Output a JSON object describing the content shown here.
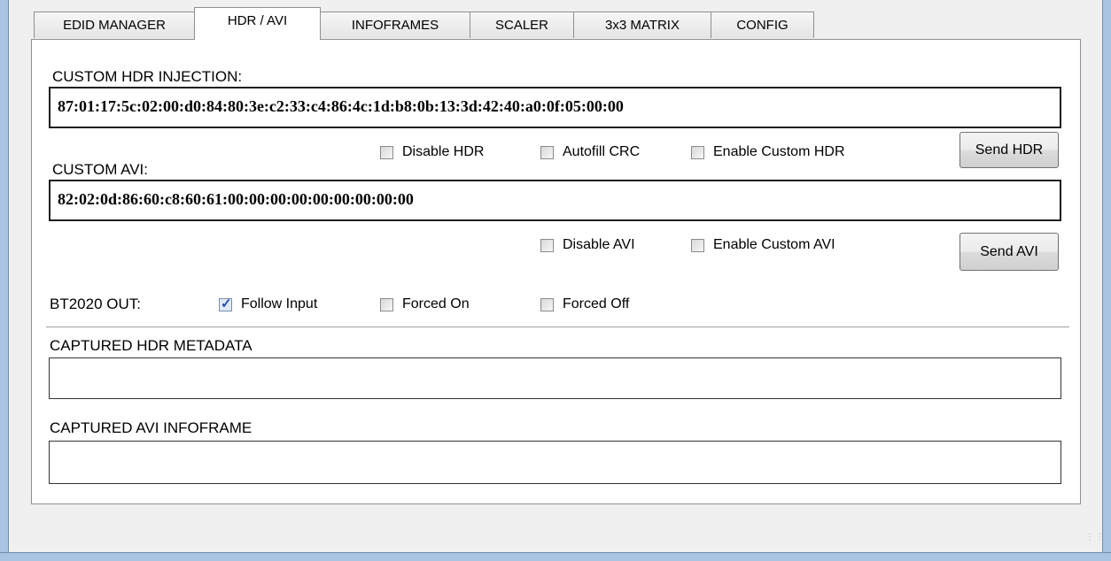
{
  "tabs": [
    {
      "label": "EDID MANAGER",
      "active": false
    },
    {
      "label": "HDR / AVI",
      "active": true
    },
    {
      "label": "INFOFRAMES",
      "active": false
    },
    {
      "label": "SCALER",
      "active": false
    },
    {
      "label": "3x3 MATRIX",
      "active": false
    },
    {
      "label": "CONFIG",
      "active": false
    }
  ],
  "hdr": {
    "label": "CUSTOM HDR INJECTION:",
    "value": "87:01:17:5c:02:00:d0:84:80:3e:c2:33:c4:86:4c:1d:b8:0b:13:3d:42:40:a0:0f:05:00:00",
    "disable_label": "Disable HDR",
    "disable_checked": false,
    "autofill_label": "Autofill CRC",
    "autofill_checked": false,
    "enable_label": "Enable Custom HDR",
    "enable_checked": false,
    "send_label": "Send HDR"
  },
  "avi": {
    "label": "CUSTOM AVI:",
    "value": "82:02:0d:86:60:c8:60:61:00:00:00:00:00:00:00:00:00",
    "disable_label": "Disable AVI",
    "disable_checked": false,
    "enable_label": "Enable Custom AVI",
    "enable_checked": false,
    "send_label": "Send AVI"
  },
  "bt2020": {
    "label": "BT2020 OUT:",
    "options": [
      {
        "label": "Follow Input",
        "checked": true
      },
      {
        "label": "Forced On",
        "checked": false
      },
      {
        "label": "Forced Off",
        "checked": false
      }
    ]
  },
  "captured": {
    "hdr_label": "CAPTURED HDR METADATA",
    "hdr_value": "",
    "avi_label": "CAPTURED AVI INFOFRAME",
    "avi_value": ""
  },
  "icons": {
    "check_mark": "✓"
  }
}
